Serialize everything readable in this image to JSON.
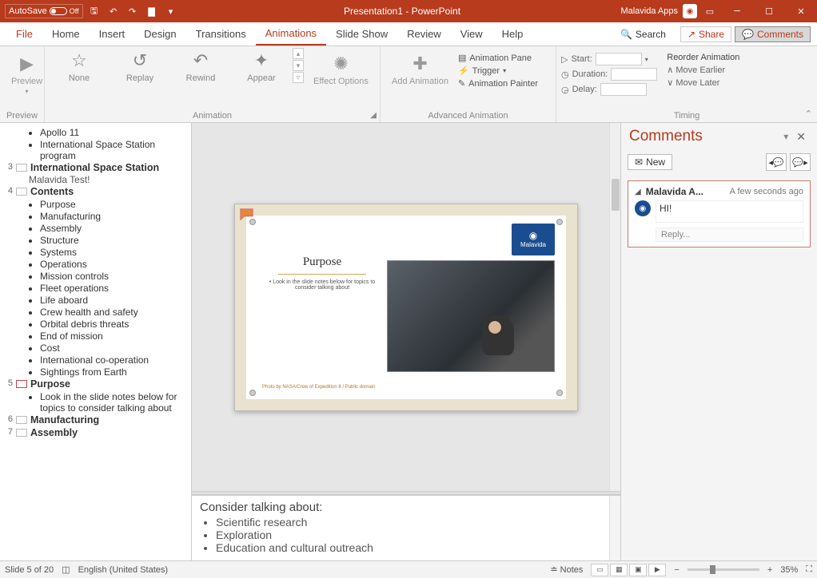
{
  "titlebar": {
    "autosave_label": "AutoSave",
    "autosave_state": "Off",
    "document_title": "Presentation1 - PowerPoint",
    "user_name": "Malavida Apps"
  },
  "tabs": {
    "items": [
      "File",
      "Home",
      "Insert",
      "Design",
      "Transitions",
      "Animations",
      "Slide Show",
      "Review",
      "View",
      "Help"
    ],
    "active": "Animations",
    "search_label": "Search",
    "share_label": "Share",
    "comments_label": "Comments"
  },
  "ribbon": {
    "preview": {
      "label": "Preview",
      "group": "Preview"
    },
    "animation": {
      "group": "Animation",
      "items": [
        "None",
        "Replay",
        "Rewind",
        "Appear"
      ],
      "effect_options": "Effect Options"
    },
    "advanced": {
      "group": "Advanced Animation",
      "add": "Add Animation",
      "pane": "Animation Pane",
      "trigger": "Trigger",
      "painter": "Animation Painter"
    },
    "timing": {
      "group": "Timing",
      "start": "Start:",
      "duration": "Duration:",
      "delay": "Delay:",
      "reorder": "Reorder Animation",
      "earlier": "Move Earlier",
      "later": "Move Later"
    }
  },
  "outline": {
    "slides": [
      {
        "num": "",
        "title": "",
        "bullets": [
          "Apollo 11",
          "International Space Station program"
        ]
      },
      {
        "num": "3",
        "title": "International Space Station",
        "sub": "Malavida Test!"
      },
      {
        "num": "4",
        "title": "Contents",
        "bullets": [
          "Purpose",
          "Manufacturing",
          "Assembly",
          "Structure",
          "Systems",
          "Operations",
          "Mission controls",
          "Fleet operations",
          "Life aboard",
          "Crew health and safety",
          "Orbital debris threats",
          "End of mission",
          "Cost",
          "International co-operation",
          "Sightings from Earth"
        ]
      },
      {
        "num": "5",
        "title": "Purpose",
        "selected": true,
        "bullets": [
          "Look in the slide notes below for topics to consider talking about"
        ]
      },
      {
        "num": "6",
        "title": "Manufacturing"
      },
      {
        "num": "7",
        "title": "Assembly"
      }
    ]
  },
  "slide": {
    "title": "Purpose",
    "body": "Look in the slide notes below for topics to consider talking about",
    "logo": "Malavida",
    "credit": "Photo by NASA/Crew of Expedition 8 / Public domain"
  },
  "notes": {
    "heading": "Consider talking about:",
    "items": [
      "Scientific research",
      "Exploration",
      "Education and cultural outreach"
    ]
  },
  "comments_pane": {
    "title": "Comments",
    "new_label": "New",
    "thread": {
      "author": "Malavida A...",
      "time": "A few seconds ago",
      "text": "HI!",
      "reply_placeholder": "Reply..."
    }
  },
  "statusbar": {
    "slide_pos": "Slide 5 of 20",
    "language": "English (United States)",
    "notes_label": "Notes",
    "zoom": "35%"
  }
}
